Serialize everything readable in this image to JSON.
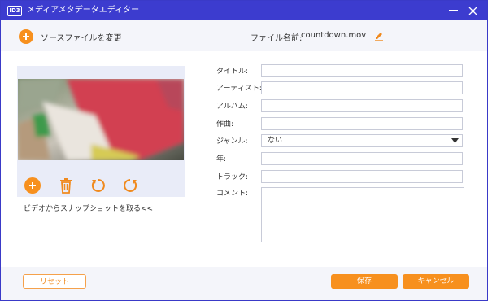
{
  "window": {
    "title": "メディアメタデータエディター",
    "app_icon_text": "ID3",
    "minimize_icon": "minimize-icon",
    "close_icon": "close-icon"
  },
  "toolbar": {
    "change_source_label": "ソースファイルを変更",
    "filename_label": "ファイル名前:",
    "filename_value": "countdown.mov",
    "edit_icon": "pencil-icon"
  },
  "preview": {
    "controls": [
      "add-icon",
      "trash-icon",
      "rotate-left-icon",
      "rotate-right-icon"
    ],
    "snapshot_link": "ビデオからスナップショットを取る<<"
  },
  "fields": {
    "title_label": "タイトル:",
    "artist_label": "アーティスト:",
    "album_label": "アルバム:",
    "composer_label": "作曲:",
    "genre_label": "ジャンル:",
    "genre_value": "ない",
    "year_label": "年:",
    "track_label": "トラック:",
    "comment_label": "コメント:"
  },
  "footer": {
    "reset_label": "リセット",
    "save_label": "保存",
    "cancel_label": "キャンセル"
  },
  "colors": {
    "titlebar": "#3c3ccf",
    "accent_orange": "#f7901e",
    "panel_bg": "#f4f5fa"
  }
}
